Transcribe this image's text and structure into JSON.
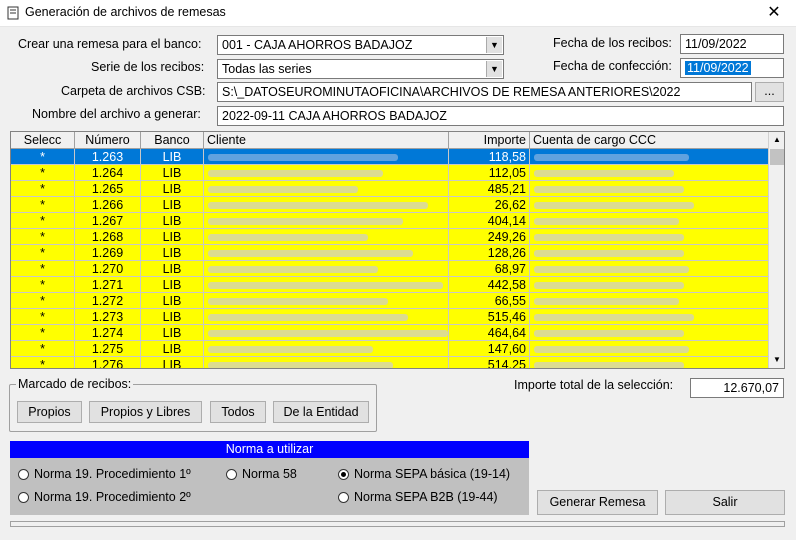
{
  "window": {
    "title": "Generación de archivos de remesas",
    "close_glyph": "✕"
  },
  "form": {
    "banco_label": "Crear una remesa para el banco:",
    "banco_value": "001 - CAJA AHORROS BADAJOZ",
    "serie_label": "Serie de los recibos:",
    "serie_value": "Todas las series",
    "carpeta_label": "Carpeta de archivos CSB:",
    "carpeta_value": "S:\\_DATOSEUROMINUTAOFICINA\\ARCHIVOS DE REMESA ANTERIORES\\2022",
    "browse_label": "...",
    "nombre_label": "Nombre del archivo a generar:",
    "nombre_value": "2022-09-11 CAJA AHORROS BADAJOZ",
    "fecha_recibos_label": "Fecha de los recibos:",
    "fecha_recibos_value": "11/09/2022",
    "fecha_confeccion_label": "Fecha de confección:",
    "fecha_confeccion_value": "11/09/2022"
  },
  "grid": {
    "columns": [
      "Selecc",
      "Número",
      "Banco",
      "Cliente",
      "Importe",
      "Cuenta de cargo CCC"
    ],
    "rows": [
      {
        "sel": "*",
        "numero": "1.263",
        "banco": "LIB",
        "importe": "118,58"
      },
      {
        "sel": "*",
        "numero": "1.264",
        "banco": "LIB",
        "importe": "112,05"
      },
      {
        "sel": "*",
        "numero": "1.265",
        "banco": "LIB",
        "importe": "485,21"
      },
      {
        "sel": "*",
        "numero": "1.266",
        "banco": "LIB",
        "importe": "26,62"
      },
      {
        "sel": "*",
        "numero": "1.267",
        "banco": "LIB",
        "importe": "404,14"
      },
      {
        "sel": "*",
        "numero": "1.268",
        "banco": "LIB",
        "importe": "249,26"
      },
      {
        "sel": "*",
        "numero": "1.269",
        "banco": "LIB",
        "importe": "128,26"
      },
      {
        "sel": "*",
        "numero": "1.270",
        "banco": "LIB",
        "importe": "68,97"
      },
      {
        "sel": "*",
        "numero": "1.271",
        "banco": "LIB",
        "importe": "442,58"
      },
      {
        "sel": "*",
        "numero": "1.272",
        "banco": "LIB",
        "importe": "66,55"
      },
      {
        "sel": "*",
        "numero": "1.273",
        "banco": "LIB",
        "importe": "515,46"
      },
      {
        "sel": "*",
        "numero": "1.274",
        "banco": "LIB",
        "importe": "464,64"
      },
      {
        "sel": "*",
        "numero": "1.275",
        "banco": "LIB",
        "importe": "147,60"
      },
      {
        "sel": "*",
        "numero": "1.276",
        "banco": "LIB",
        "importe": "514,25"
      }
    ]
  },
  "marcado": {
    "title": "Marcado de recibos:",
    "propios": "Propios",
    "propios_libres": "Propios y Libres",
    "todos": "Todos",
    "entidad": "De la Entidad"
  },
  "total": {
    "label": "Importe total de la selección:",
    "value": "12.670,07"
  },
  "norma": {
    "title": "Norma a utilizar",
    "options": [
      "Norma 19. Procedimiento 1º",
      "Norma 58",
      "Norma SEPA básica (19-14)",
      "Norma 19. Procedimiento 2º",
      "Norma SEPA B2B (19-44)"
    ],
    "selected": "Norma SEPA básica (19-14)"
  },
  "actions": {
    "generar": "Generar Remesa",
    "salir": "Salir"
  },
  "colors": {
    "row_highlight": "#ffff00",
    "selection": "#0078d7",
    "norma_header": "#0000ff"
  }
}
